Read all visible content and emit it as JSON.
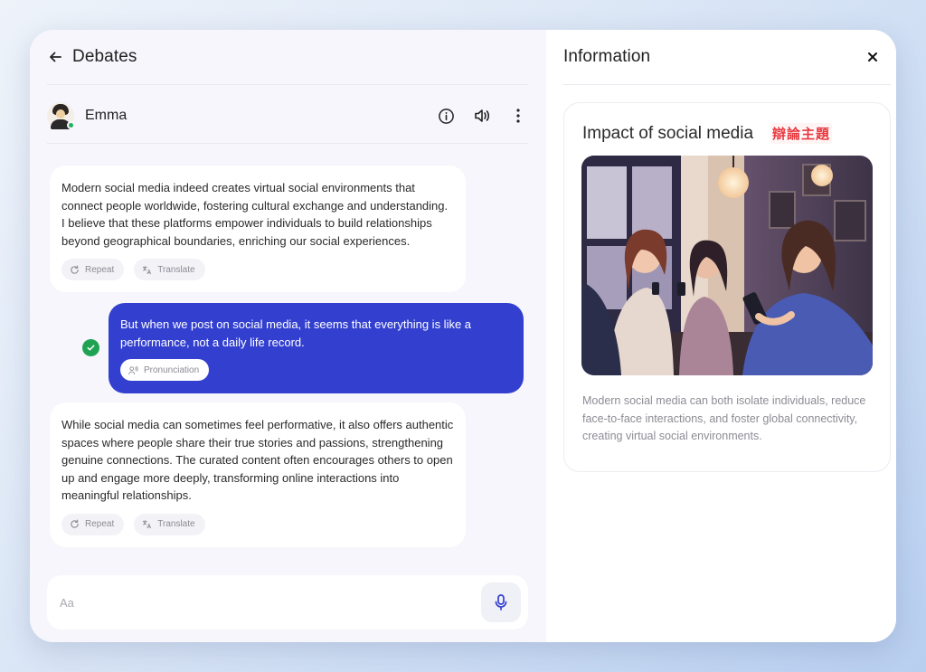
{
  "header": {
    "title": "Debates"
  },
  "contact": {
    "name": "Emma"
  },
  "messages": [
    {
      "role": "bot",
      "text": "Modern social media indeed creates virtual social environments that connect people worldwide, fostering cultural exchange and understanding. I believe that these platforms empower individuals to build relationships beyond geographical boundaries, enriching our social experiences.",
      "actions": {
        "repeat": "Repeat",
        "translate": "Translate"
      }
    },
    {
      "role": "user",
      "text": "But when we post on social media, it seems that everything is like a performance, not a daily life record.",
      "actions": {
        "pronunciation": "Pronunciation"
      }
    },
    {
      "role": "bot",
      "text": "While social media can sometimes feel performative, it also offers authentic spaces where people share their true stories and passions, strengthening genuine connections. The curated content often encourages others to open up and engage more deeply, transforming online interactions into meaningful relationships.",
      "actions": {
        "repeat": "Repeat",
        "translate": "Translate"
      }
    }
  ],
  "input": {
    "placeholder": "Aa"
  },
  "info": {
    "title": "Information",
    "topic_title": "Impact of social media",
    "topic_tag": "辯論主題",
    "description": "Modern social media can both isolate individuals, reduce face-to-face interactions, and foster global connectivity, creating virtual social environments."
  },
  "colors": {
    "accent": "#3340cf",
    "online": "#22b05a",
    "check": "#1fa353",
    "tag": "#e8383f"
  },
  "icons": {
    "back": "arrow-left-icon",
    "info": "info-circle-icon",
    "speaker": "speaker-icon",
    "more": "more-vertical-icon",
    "repeat": "repeat-icon",
    "translate": "translate-icon",
    "pronunciation": "pronunciation-icon",
    "check": "check-icon",
    "mic": "microphone-icon",
    "close": "close-icon"
  }
}
